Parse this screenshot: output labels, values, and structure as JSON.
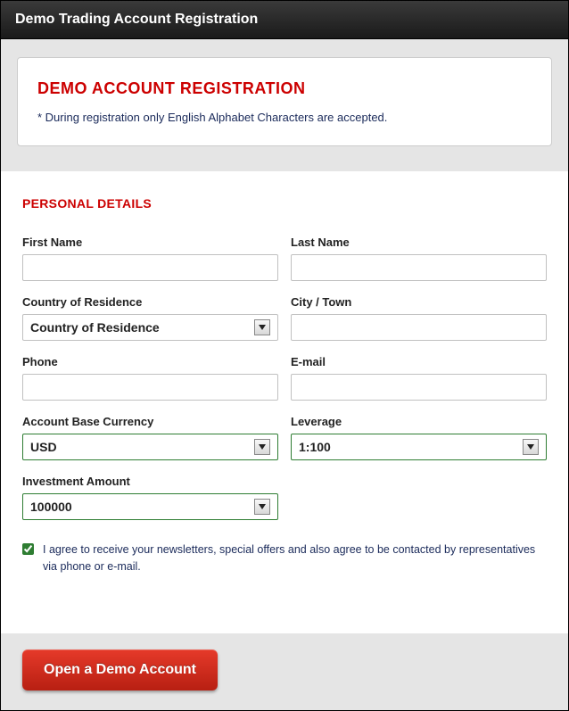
{
  "window": {
    "title": "Demo Trading Account Registration"
  },
  "info": {
    "title": "DEMO ACCOUNT REGISTRATION",
    "note": "* During registration only English Alphabet Characters are accepted."
  },
  "section_title": "PERSONAL DETAILS",
  "fields": {
    "first_name": {
      "label": "First Name",
      "value": ""
    },
    "last_name": {
      "label": "Last Name",
      "value": ""
    },
    "country": {
      "label": "Country of Residence",
      "selected": "Country of Residence"
    },
    "city": {
      "label": "City / Town",
      "value": ""
    },
    "phone": {
      "label": "Phone",
      "value": ""
    },
    "email": {
      "label": "E-mail",
      "value": ""
    },
    "currency": {
      "label": "Account Base Currency",
      "selected": "USD"
    },
    "leverage": {
      "label": "Leverage",
      "selected": "1:100"
    },
    "investment": {
      "label": "Investment Amount",
      "selected": "100000"
    }
  },
  "consent": {
    "checked": true,
    "text": "I agree to receive your newsletters, special offers and also agree to be contacted by representatives via phone or e-mail."
  },
  "submit_label": "Open a Demo Account"
}
